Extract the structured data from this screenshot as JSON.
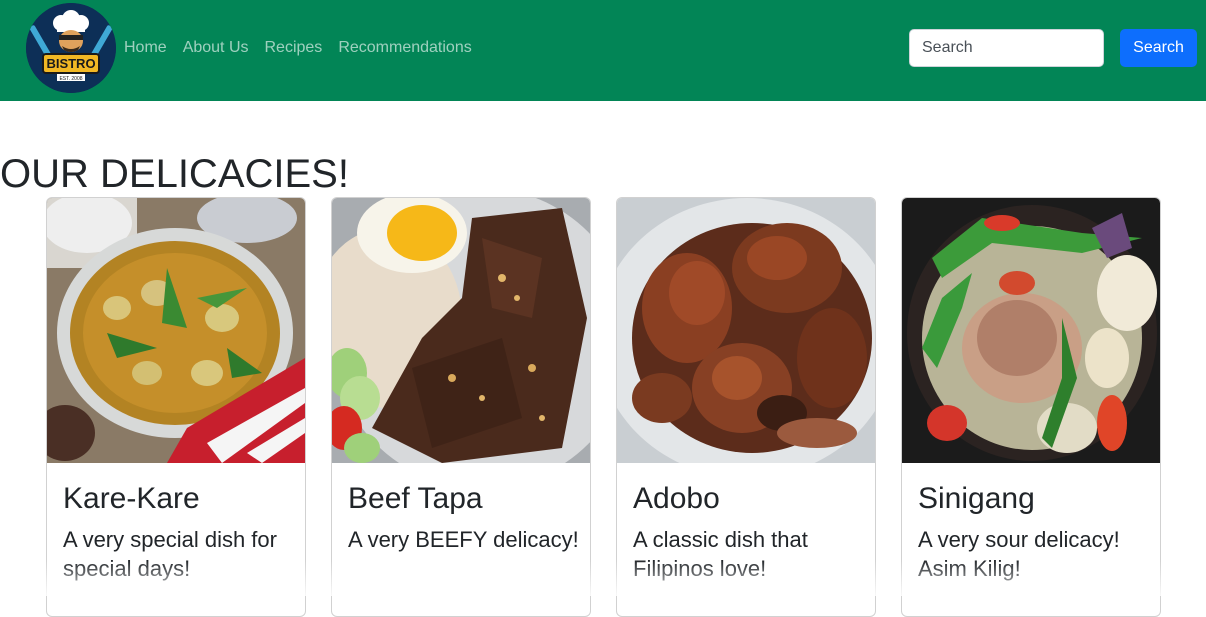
{
  "brand": {
    "logo_text": "BISTRO",
    "logo_subtext": "EST. 2008",
    "colors": {
      "navbar": "#028556",
      "logo_bg": "#0d2f57",
      "logo_accent": "#f2b824"
    }
  },
  "nav": {
    "items": [
      {
        "label": "Home"
      },
      {
        "label": "About Us"
      },
      {
        "label": "Recipes"
      },
      {
        "label": "Recommendations"
      }
    ]
  },
  "search": {
    "placeholder": "Search",
    "button_label": "Search",
    "button_color": "#0d6efd"
  },
  "main": {
    "title": "OUR DELICACIES!",
    "cards": [
      {
        "title": "Kare-Kare",
        "text": "A very special dish for special days!",
        "image": "kare-kare-photo"
      },
      {
        "title": "Beef Tapa",
        "text": "A very BEEFY delicacy!",
        "image": "beef-tapa-photo"
      },
      {
        "title": "Adobo",
        "text": "A classic dish that Filipinos love!",
        "image": "adobo-photo"
      },
      {
        "title": "Sinigang",
        "text": "A very sour delicacy! Asim Kilig!",
        "image": "sinigang-photo"
      }
    ]
  }
}
